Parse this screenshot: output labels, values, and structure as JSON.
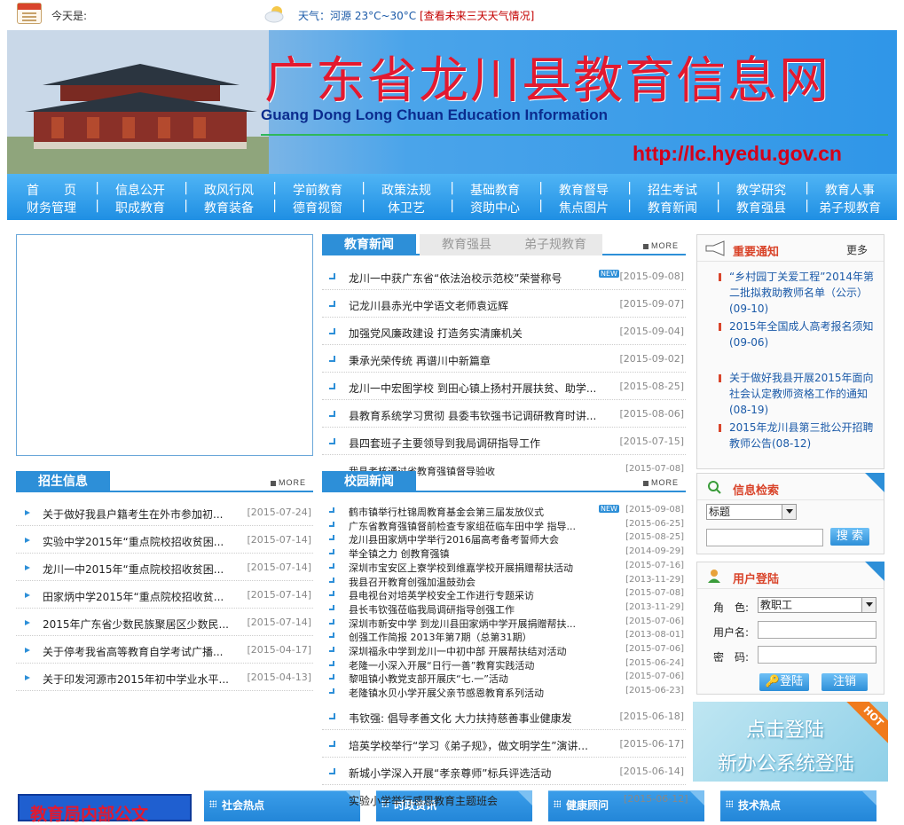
{
  "topbar": {
    "today_label": "今天是:",
    "weather_text": "天气：河源 23°C~30°C",
    "weather_link": "[查看未来三天天气情况]"
  },
  "banner": {
    "title": "广东省龙川县教育信息网",
    "subtitle": "Guang Dong Long Chuan Education Information",
    "url": "http://lc.hyedu.gov.cn"
  },
  "nav": {
    "row1": [
      "首　　页",
      "信息公开",
      "政风行风",
      "学前教育",
      "政策法规",
      "基础教育",
      "教育督导",
      "招生考试",
      "教学研究",
      "教育人事"
    ],
    "row2": [
      "财务管理",
      "职成教育",
      "教育装备",
      "德育视窗",
      "体卫艺",
      "资助中心",
      "焦点图片",
      "教育新闻",
      "教育强县",
      "弟子规教育"
    ]
  },
  "news_tabs": {
    "active": "教育新闻",
    "tab2": "教育强县",
    "tab3": "弟子规教育",
    "more": "MORE"
  },
  "news": [
    {
      "title": "龙川一中获广东省“依法治校示范校”荣誉称号",
      "date": "[2015-09-08]",
      "new": "NEW"
    },
    {
      "title": "记龙川县赤光中学语文老师袁远辉",
      "date": "[2015-09-07]"
    },
    {
      "title": "加强党风廉政建设 打造务实清廉机关",
      "date": "[2015-09-04]"
    },
    {
      "title": "秉承光荣传统 再谱川中新篇章",
      "date": "[2015-09-02]"
    },
    {
      "title": "龙川一中宏图学校 到田心镇上扬村开展扶贫、助学...",
      "date": "[2015-08-25]"
    },
    {
      "title": "县教育系统学习贯彻 县委韦钦强书记调研教育时讲...",
      "date": "[2015-08-06]"
    },
    {
      "title": "县四套班子主要领导到我局调研指导工作",
      "date": "[2015-07-15]"
    }
  ],
  "campus": {
    "tab": "校园新闻",
    "more": "MORE",
    "partial_top": "我县考核通过省教育强镇督导验收",
    "partial_top_date": "[2015-07-08]",
    "items": [
      {
        "title": "鹤市镇举行杜锦周教育基金会第三届发放仪式",
        "date": "[2015-09-08]",
        "new": "NEW"
      },
      {
        "title": "广东省教育强镇督前检查专家组莅临车田中学 指导...",
        "date": "[2015-06-25]"
      },
      {
        "title": "龙川县田家炳中学举行2016届高考备考誓师大会",
        "date": "[2015-08-25]"
      },
      {
        "title": "举全镇之力 创教育强镇",
        "date": "[2014-09-29]"
      },
      {
        "title": "深圳市宝安区上寮学校到维嘉学校开展捐赠帮扶活动",
        "date": "[2015-07-16]"
      },
      {
        "title": "我县召开教育创强加温鼓劲会",
        "date": "[2013-11-29]"
      },
      {
        "title": "县电视台对培英学校安全工作进行专题采访",
        "date": "[2015-07-08]"
      },
      {
        "title": "县长韦钦强莅临我局调研指导创强工作",
        "date": "[2013-11-29]"
      },
      {
        "title": "深圳市新安中学 到龙川县田家炳中学开展捐赠帮扶...",
        "date": "[2015-07-06]"
      },
      {
        "title": "创强工作简报 2013年第7期（总第31期）",
        "date": "[2013-08-01]"
      },
      {
        "title": "深圳福永中学到龙川一中初中部 开展帮扶结对活动",
        "date": "[2015-07-06]"
      },
      {
        "title": "老隆一小深入开展“日行一善”教育实践活动",
        "date": "[2015-06-24]"
      },
      {
        "title": "黎咀镇小教党支部开展庆“七.一”活动",
        "date": "[2015-07-06]"
      },
      {
        "title": "老隆镇水贝小学开展父亲节感恩教育系列活动",
        "date": "[2015-06-23]"
      }
    ],
    "after": [
      {
        "title": "韦钦强: 倡导孝善文化 大力扶持慈善事业健康发",
        "date": "[2015-06-18]"
      },
      {
        "title": "培英学校举行“学习《弟子规》，做文明学生”演讲...",
        "date": "[2015-06-17]"
      },
      {
        "title": "新城小学深入开展“孝亲尊师”标兵评选活动",
        "date": "[2015-06-14]"
      }
    ],
    "bottom_cut": "实验小学举行感恩教育主题班会",
    "bottom_cut_date": "[2015-06-12]"
  },
  "enroll": {
    "tab": "招生信息",
    "more": "MORE",
    "items": [
      {
        "title": "关于做好我县户籍考生在外市参加初...",
        "date": "[2015-07-24]"
      },
      {
        "title": "实验中学2015年“重点院校招收贫困...",
        "date": "[2015-07-14]"
      },
      {
        "title": "龙川一中2015年“重点院校招收贫困...",
        "date": "[2015-07-14]"
      },
      {
        "title": "田家炳中学2015年“重点院校招收贫...",
        "date": "[2015-07-14]"
      },
      {
        "title": "2015年广东省少数民族聚居区少数民...",
        "date": "[2015-07-14]"
      },
      {
        "title": "关于停考我省高等教育自学考试广播...",
        "date": "[2015-04-17]"
      },
      {
        "title": "关于印发河源市2015年初中学业水平...",
        "date": "[2015-04-13]"
      }
    ]
  },
  "notices": {
    "title": "重要通知",
    "more": "更多",
    "items": [
      {
        "text": "“乡村园丁关爱工程”2014年第二批拟救助教师名单（公示）(09-10)"
      },
      {
        "text": "2015年全国成人高考报名须知(09-06)"
      },
      {
        "text": "关于做好我县开展2015年面向社会认定教师资格工作的通知(08-19)"
      },
      {
        "text": "2015年龙川县第三批公开招聘教师公告(08-12)"
      }
    ]
  },
  "search": {
    "title": "信息检索",
    "field_value": "标题",
    "button": "搜 索"
  },
  "login": {
    "title": "用户登陆",
    "role_label": "角　色:",
    "role_value": "教职工",
    "user_label": "用户名:",
    "pass_label": "密　码:",
    "login_btn": "登陆",
    "logout_btn": "注销"
  },
  "promo": {
    "line1": "点击登陆",
    "line2": "新办公系统登陆",
    "badge": "HOT"
  },
  "bottom": {
    "red_box": "教育局内部公文",
    "tabs": [
      "社会热点",
      "时政资讯",
      "健康顾问",
      "技术热点"
    ]
  },
  "colors": {
    "brand_blue": "#2d8fd8",
    "title_red": "#e3192f",
    "notice_blue": "#1b5aa8"
  }
}
